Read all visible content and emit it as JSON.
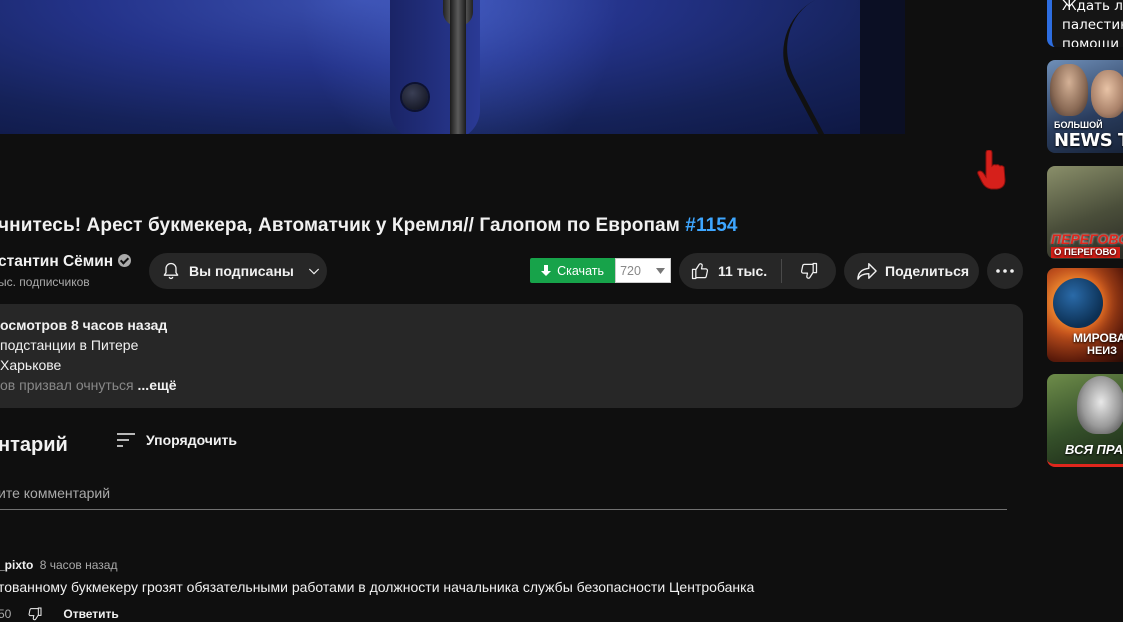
{
  "video": {
    "title": "чнитесь! Арест букмекера, Автоматчик у Кремля// Галопом по Европам",
    "hashtag": "#1154"
  },
  "channel": {
    "name": "стантин Сёмин",
    "subscribers": "ыс. подписчиков"
  },
  "actions": {
    "subscribed_label": "Вы подписаны",
    "download_label": "Скачать",
    "download_quality": "720",
    "likes": "11 тыс.",
    "share_label": "Поделиться"
  },
  "description": {
    "stats": "осмотров  8 часов назад",
    "line2": " подстанции в Питере",
    "line3": " Харькове",
    "line4_a": "ов призвал очнуться",
    "line4_b": " ...ещё"
  },
  "comments": {
    "count_label": "нтарий",
    "sort_label": "Упорядочить",
    "input_placeholder": "ите комментарий",
    "items": [
      {
        "author": "_pixto",
        "time": "8 часов назад",
        "text": "тованному букмекеру грозят обязательными работами в должности начальника службы безопасности Центробанка",
        "likes": "50",
        "reply_label": "Ответить"
      }
    ]
  },
  "sidebar": {
    "items": [
      {
        "lines": [
          "Ждать ли",
          "палестин",
          "помощи"
        ]
      },
      {
        "top": "БОЛЬШОЙ",
        "big": "NEWS TAL"
      },
      {
        "big": "ПЕРЕГОВО",
        "small": "О ПЕРЕГОВО"
      },
      {
        "big": "МИРОВА",
        "small": "НЕИЗ"
      },
      {
        "big": "ВСЯ ПРАВ"
      }
    ]
  },
  "colors": {
    "background": "#0f0f0f",
    "surface": "#272727",
    "hashtag": "#3ea6ff",
    "download": "#17a34a",
    "cursor": "#d6201b"
  },
  "icons": [
    "bell-icon",
    "chevron-down-icon",
    "download-arrow-icon",
    "thumb-up-icon",
    "thumb-down-icon",
    "share-icon",
    "more-icon",
    "sort-icon",
    "verified-icon",
    "hand-cursor-icon"
  ]
}
